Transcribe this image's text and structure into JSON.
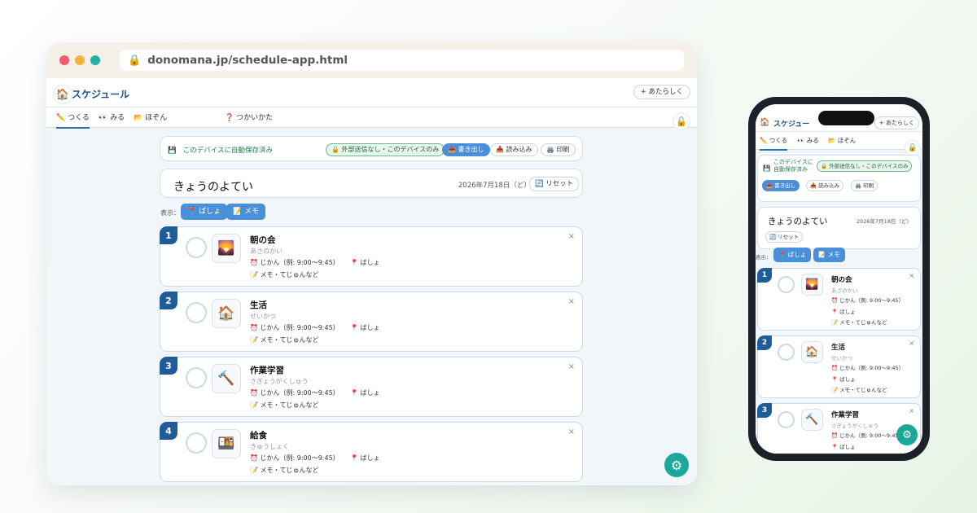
{
  "browser": {
    "url": "donomana.jp/schedule-app.html",
    "colors": {
      "close": "#f05d6c",
      "minimize": "#f5b23d",
      "maximize": "#1fb5a0"
    }
  },
  "app": {
    "title": "スケジュール",
    "title_short": "スケジュー",
    "new_button": "+ あたらしく",
    "tabs": [
      {
        "label": "✏️ つくる",
        "active": true
      },
      {
        "label": "👀 みる"
      },
      {
        "label": "📂 ほぞん"
      },
      {
        "label": "❓ つかいかた"
      }
    ],
    "save_status": "このデバイスに自動保存済み",
    "save_status_phone_1": "このデバイスに",
    "save_status_phone_2": "自動保存済み",
    "privacy_badge": "🔒 外部送信なし・このデバイスのみ",
    "export_button": "📤 書き出し",
    "import_button": "📥 読み込み",
    "print_button": "🖨️ 印刷",
    "schedule_title": "きょうのよてい",
    "date": "2026年7月18日（ど）",
    "reset_button": "🔄 リセット",
    "display_label": "表示：",
    "toggle_place": "📍 ばしょ",
    "toggle_memo": "📝 メモ",
    "time_placeholder": "⏰ じかん（例: 9:00〜9:45）",
    "place_placeholder": "📍 ばしょ",
    "memo_placeholder": "📝 メモ・てじゅんなど",
    "items": [
      {
        "num": "1",
        "name": "朝の会",
        "kana": "あさのかい",
        "icon": "🌄"
      },
      {
        "num": "2",
        "name": "生活",
        "kana": "せいかつ",
        "icon": "🏠"
      },
      {
        "num": "3",
        "name": "作業学習",
        "kana": "さぎょうがくしゅう",
        "icon": "🔨"
      },
      {
        "num": "4",
        "name": "給食",
        "kana": "きゅうしょく",
        "icon": "🍱"
      }
    ],
    "close_glyph": "×",
    "gear_glyph": "⚙",
    "lock_glyph": "🔓",
    "logo_glyph": "🏠",
    "save_glyph": "💾"
  }
}
